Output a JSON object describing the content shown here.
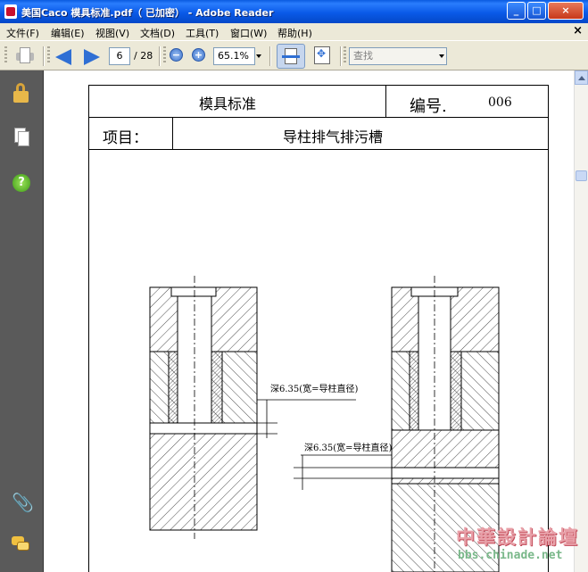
{
  "window": {
    "title": "美国Caco 模具标准.pdf（ 已加密） - Adobe Reader"
  },
  "menu": {
    "items": [
      "文件(F)",
      "编辑(E)",
      "视图(V)",
      "文档(D)",
      "工具(T)",
      "窗口(W)",
      "帮助(H)"
    ],
    "close_glyph": "×"
  },
  "toolbar": {
    "current_page": "6",
    "page_count": "/ 28",
    "zoom_out": "−",
    "zoom_in": "+",
    "zoom": "65.1%",
    "search_placeholder": "查找"
  },
  "window_buttons": {
    "minimize": "_",
    "maximize": "□",
    "close": "×"
  },
  "sidebar": {
    "icons": [
      "lock-icon",
      "pages-icon",
      "help-icon",
      "attachment-icon",
      "comments-icon"
    ],
    "help_glyph": "?",
    "clip_glyph": "📎"
  },
  "document": {
    "header": {
      "title": "模具标准",
      "number_label": "编号.",
      "number": "006",
      "item_label": "项目：",
      "item_value": "导柱排气排污槽"
    },
    "annotations": {
      "left": "深6.35(宽=导柱直径)",
      "right": "深6.35(宽=导柱直径)"
    }
  },
  "watermark": {
    "line1": "中華設計論壇",
    "line2": "bbs.chinade.net"
  }
}
